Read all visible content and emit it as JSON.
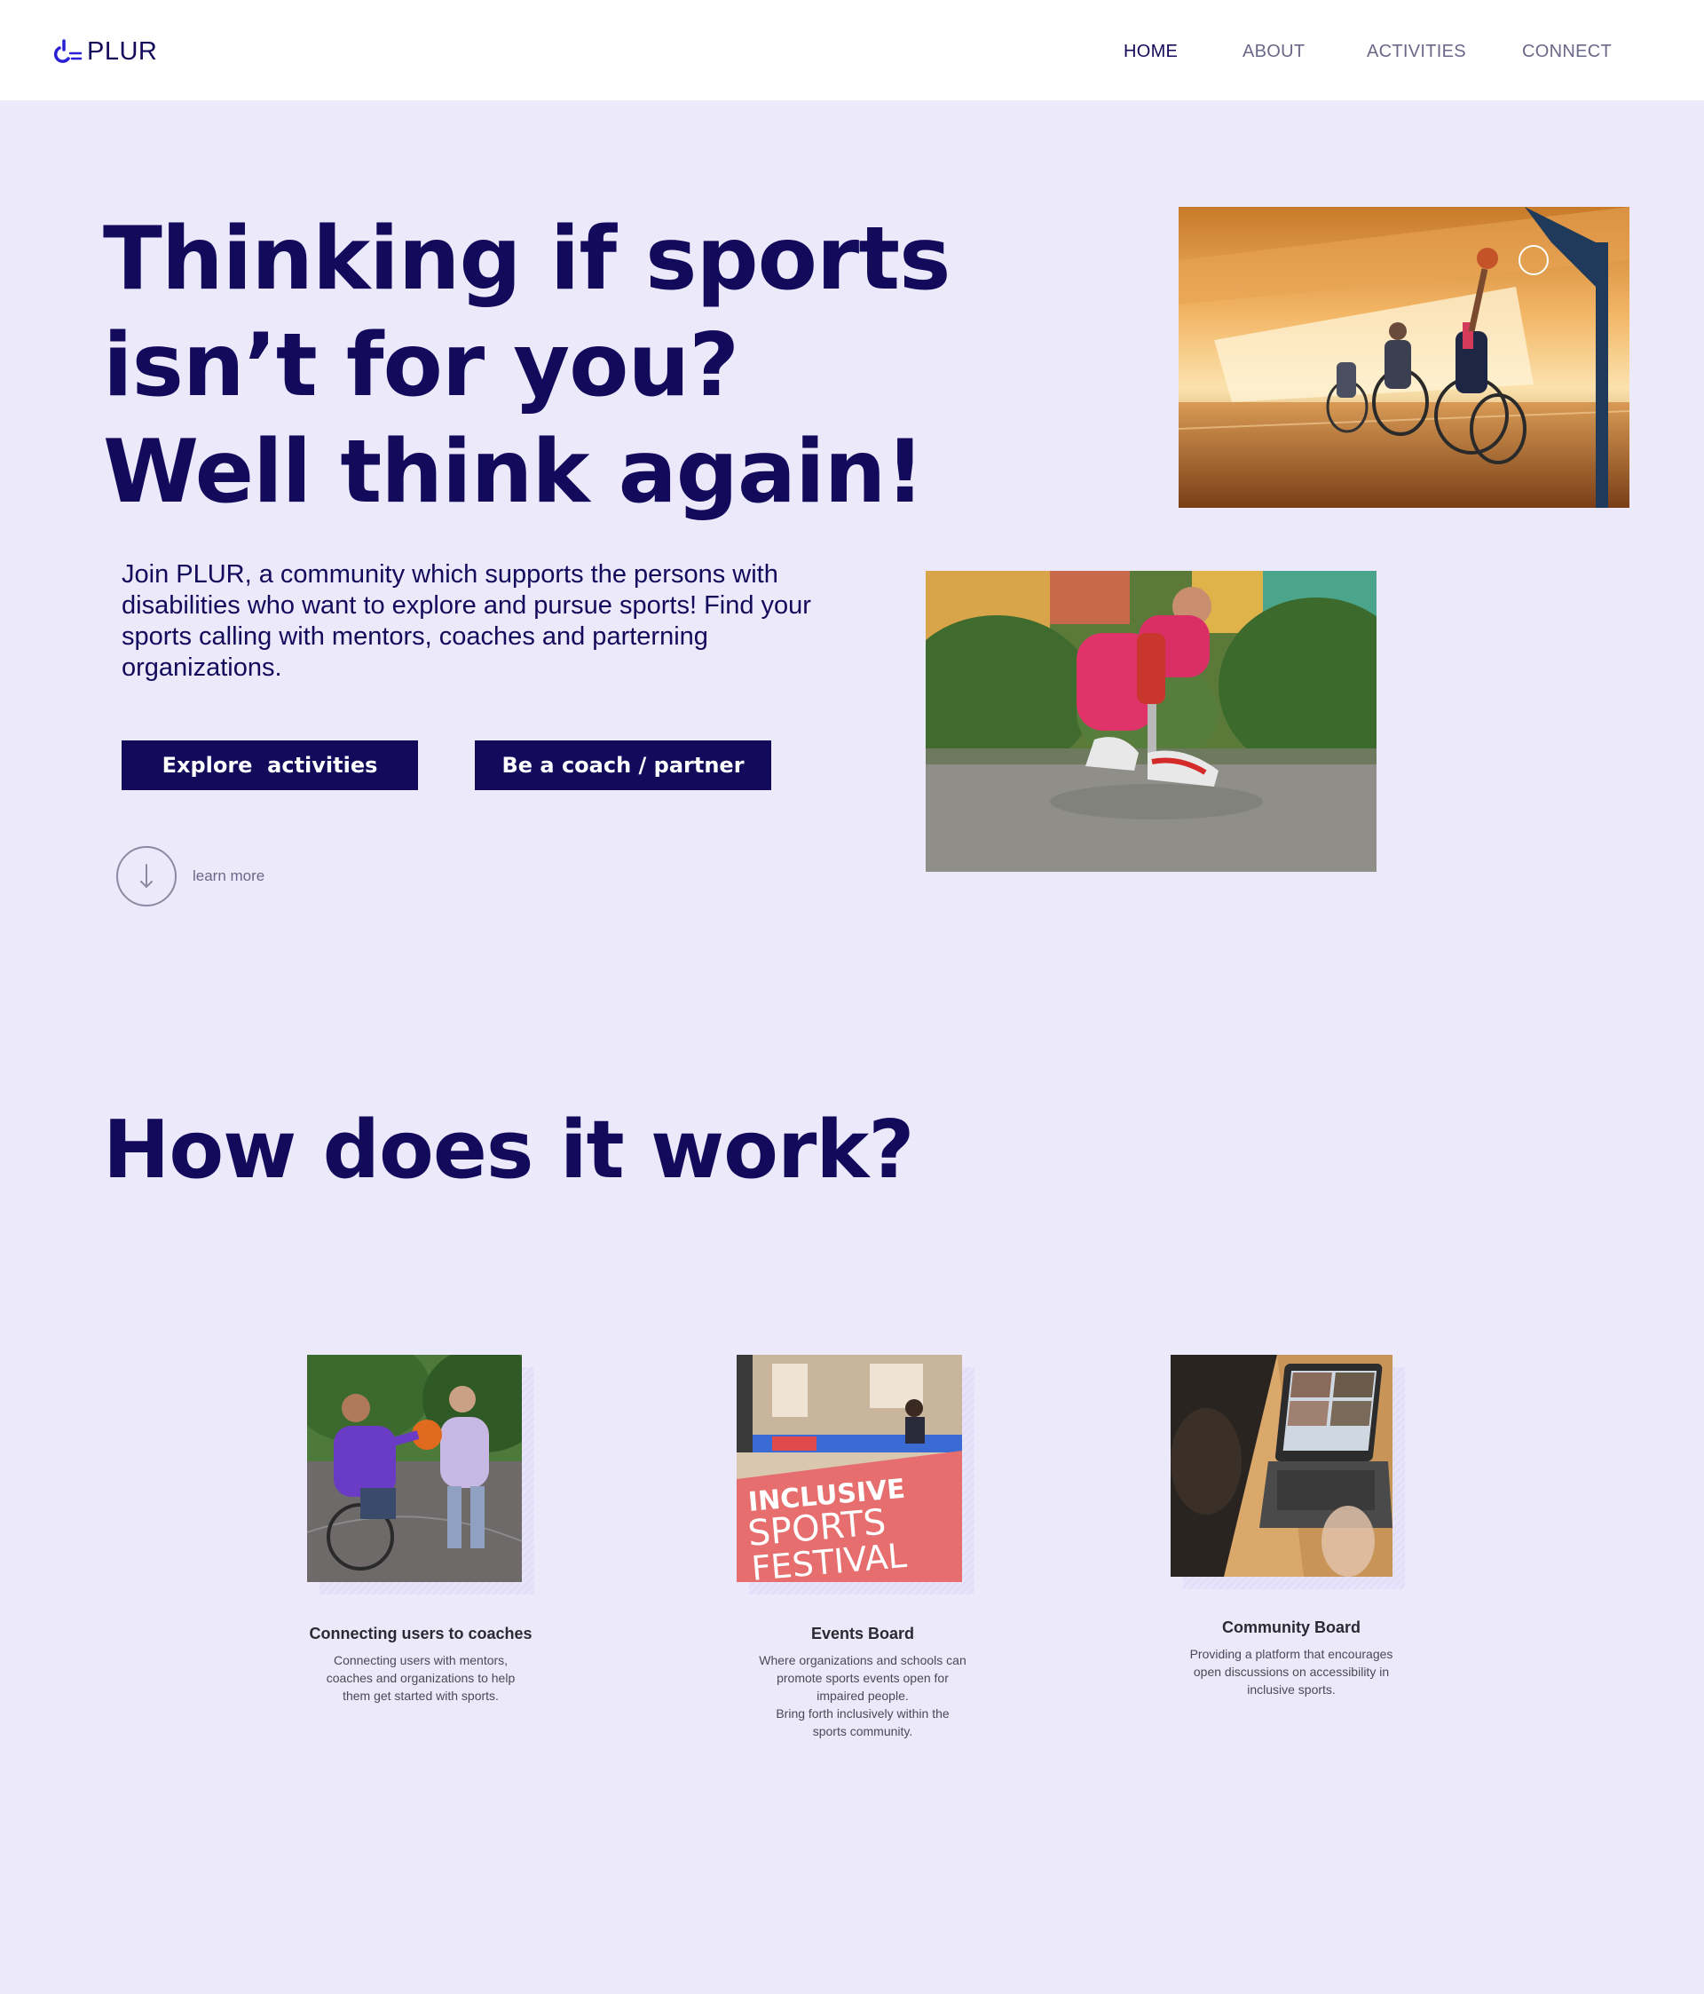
{
  "brand": {
    "name": "PLUR"
  },
  "nav": {
    "items": [
      {
        "label": "HOME"
      },
      {
        "label": "ABOUT"
      },
      {
        "label": "ACTIVITIES"
      },
      {
        "label": "CONNECT"
      }
    ]
  },
  "hero": {
    "title_lines": [
      "Thinking if sports",
      "isn’t for you?",
      "Well think again!"
    ],
    "description": "Join PLUR, a community which supports the persons with disabilities who want to explore and pursue sports! Find your sports calling with mentors, coaches and parterning organizations.",
    "buttons": {
      "explore": "Explore  activities",
      "coach": "Be a coach / partner"
    },
    "learn_more": "learn more"
  },
  "how": {
    "title": "How does it work?",
    "cards": [
      {
        "title": "Connecting users to coaches",
        "desc_lines": [
          "Connecting users with mentors,",
          "coaches and organizations to help",
          "them get started with sports."
        ]
      },
      {
        "title": "Events Board",
        "image_text": [
          "INCLUSIVE",
          "SPORTS",
          "FESTIVAL"
        ],
        "desc_lines": [
          "Where organizations and schools can",
          "promote sports events open for",
          "impaired people.",
          "Bring forth inclusively within the",
          "sports community."
        ]
      },
      {
        "title": "Community Board",
        "desc_lines": [
          "Providing a platform that encourages",
          "open discussions on accessibility in",
          "inclusive sports."
        ]
      }
    ]
  },
  "colors": {
    "background": "#ece9fb",
    "primary": "#130a5c",
    "accent": "#2b1fd6"
  }
}
